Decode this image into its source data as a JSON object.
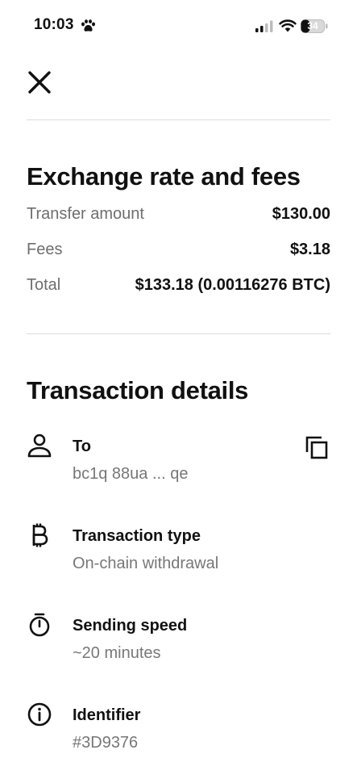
{
  "status_bar": {
    "time": "10:03",
    "battery": "34",
    "icons": [
      "paw-icon",
      "cellular-signal-icon",
      "wifi-icon",
      "battery-icon"
    ]
  },
  "header": {
    "close_icon": "close-icon"
  },
  "fees": {
    "title": "Exchange rate and fees",
    "rows": [
      {
        "label": "Transfer amount",
        "value": "$130.00"
      },
      {
        "label": "Fees",
        "value": "$3.18"
      },
      {
        "label": "Total",
        "value": "$133.18 (0.00116276 BTC)"
      }
    ]
  },
  "details": {
    "title": "Transaction details",
    "items": [
      {
        "icon": "person-icon",
        "label": "To",
        "value": "bc1q 88ua ... qe"
      },
      {
        "icon": "bitcoin-icon",
        "label": "Transaction type",
        "value": "On-chain withdrawal"
      },
      {
        "icon": "stopwatch-icon",
        "label": "Sending speed",
        "value": "~20 minutes"
      },
      {
        "icon": "info-icon",
        "label": "Identifier",
        "value": "#3D9376"
      }
    ],
    "copy_icon": "copy-icon"
  },
  "colors": {
    "text": "#111111",
    "muted": "#6e6e6e",
    "divider": "#dcdcdc",
    "background": "#ffffff"
  }
}
